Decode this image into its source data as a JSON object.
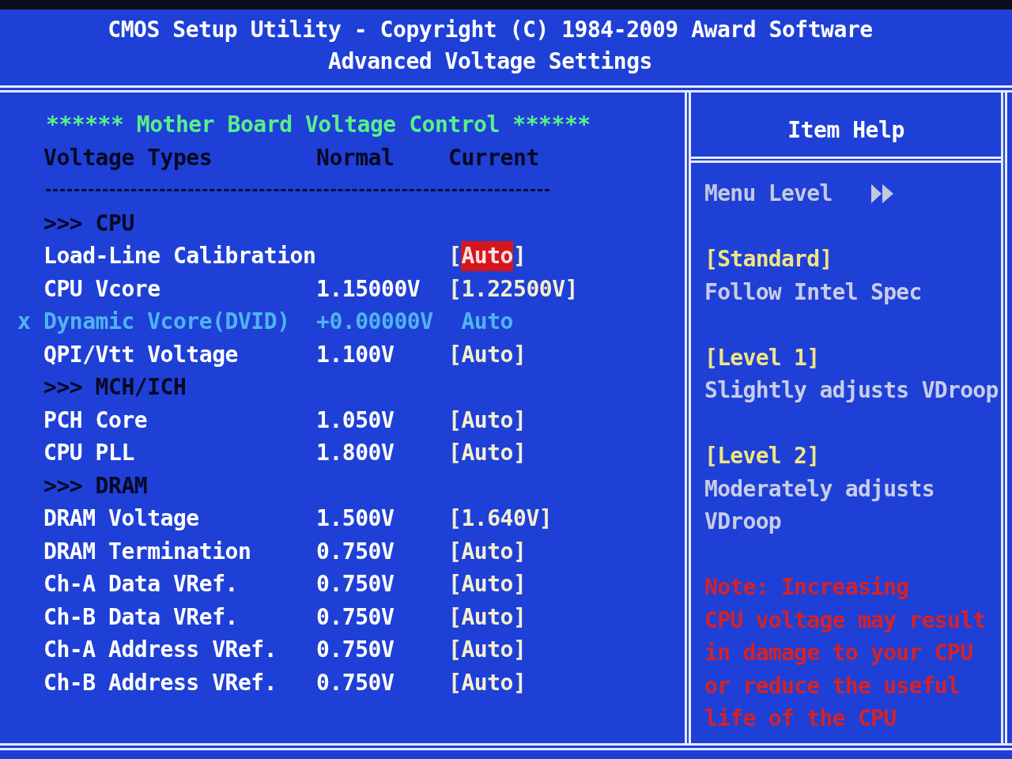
{
  "header": {
    "title": "CMOS Setup Utility - Copyright (C) 1984-2009 Award Software",
    "subtitle": "Advanced Voltage Settings"
  },
  "settings_panel": {
    "heading": "****** Mother Board Voltage Control ******",
    "columns": [
      "Voltage Types",
      "Normal",
      "Current"
    ],
    "rows": [
      {
        "kind": "section",
        "label": ">>> CPU"
      },
      {
        "kind": "setting",
        "label": "Load-Line Calibration",
        "current": {
          "left": "[",
          "value": "Auto",
          "right": "]"
        },
        "selected": true,
        "disabled": false
      },
      {
        "kind": "setting",
        "label": "CPU Vcore",
        "normal": "1.15000V",
        "current": {
          "left": "[",
          "value": "1.22500V",
          "right": "]"
        },
        "selected": false,
        "disabled": false
      },
      {
        "kind": "setting",
        "prefix": "x",
        "label": "Dynamic Vcore(DVID)",
        "normal": "+0.00000V",
        "current": {
          "value": "Auto"
        },
        "selected": false,
        "disabled": true
      },
      {
        "kind": "setting",
        "label": "QPI/Vtt Voltage",
        "normal": "1.100V",
        "current": {
          "left": "[",
          "value": "Auto",
          "right": "]"
        },
        "selected": false,
        "disabled": false
      },
      {
        "kind": "section",
        "label": ">>> MCH/ICH"
      },
      {
        "kind": "setting",
        "label": "PCH Core",
        "normal": "1.050V",
        "current": {
          "left": "[",
          "value": "Auto",
          "right": "]"
        },
        "selected": false,
        "disabled": false
      },
      {
        "kind": "setting",
        "label": "CPU PLL",
        "normal": "1.800V",
        "current": {
          "left": "[",
          "value": "Auto",
          "right": "]"
        },
        "selected": false,
        "disabled": false
      },
      {
        "kind": "section",
        "label": ">>> DRAM"
      },
      {
        "kind": "setting",
        "label": "DRAM Voltage",
        "normal": "1.500V",
        "current": {
          "left": "[",
          "value": "1.640V",
          "right": "]"
        },
        "selected": false,
        "disabled": false
      },
      {
        "kind": "setting",
        "label": "DRAM Termination",
        "normal": "0.750V",
        "current": {
          "left": "[",
          "value": "Auto",
          "right": "]"
        },
        "selected": false,
        "disabled": false
      },
      {
        "kind": "setting",
        "label": "Ch-A Data VRef.",
        "normal": "0.750V",
        "current": {
          "left": "[",
          "value": "Auto",
          "right": "]"
        },
        "selected": false,
        "disabled": false
      },
      {
        "kind": "setting",
        "label": "Ch-B Data VRef.",
        "normal": "0.750V",
        "current": {
          "left": "[",
          "value": "Auto",
          "right": "]"
        },
        "selected": false,
        "disabled": false
      },
      {
        "kind": "setting",
        "label": "Ch-A Address VRef.",
        "normal": "0.750V",
        "current": {
          "left": "[",
          "value": "Auto",
          "right": "]"
        },
        "selected": false,
        "disabled": false
      },
      {
        "kind": "setting",
        "label": "Ch-B Address VRef.",
        "normal": "0.750V",
        "current": {
          "left": "[",
          "value": "Auto",
          "right": "]"
        },
        "selected": false,
        "disabled": false
      }
    ]
  },
  "item_help": {
    "title": "Item Help",
    "menu_level": "Menu Level",
    "entries": [
      {
        "kind": "option",
        "option": "[Standard]",
        "lines": [
          "Follow Intel Spec"
        ]
      },
      {
        "kind": "option",
        "option": "[Level 1]",
        "lines": [
          "Slightly adjusts VDroop"
        ]
      },
      {
        "kind": "option",
        "option": "[Level 2]",
        "lines": [
          "Moderately adjusts",
          "VDroop"
        ]
      },
      {
        "kind": "note",
        "lines": [
          "Note: Increasing",
          "CPU voltage may result",
          "in damage to your CPU",
          "or reduce the useful",
          "life of the CPU"
        ]
      }
    ]
  }
}
